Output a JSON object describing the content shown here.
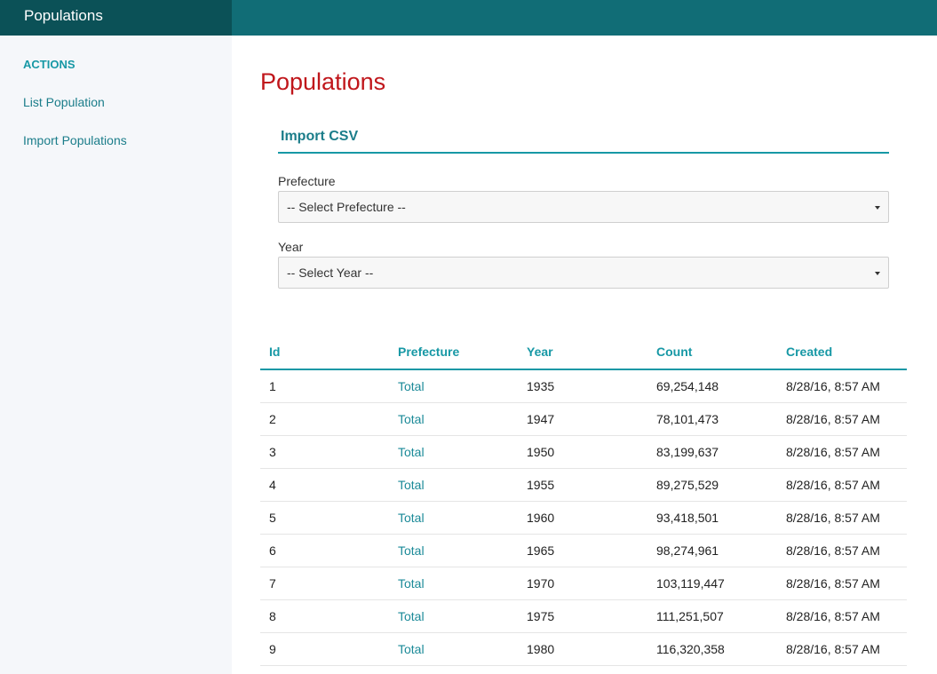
{
  "header": {
    "brand": "Populations"
  },
  "sidebar": {
    "heading": "ACTIONS",
    "items": [
      {
        "label": "List Population"
      },
      {
        "label": "Import Populations"
      }
    ]
  },
  "main": {
    "title": "Populations",
    "import_form": {
      "legend": "Import CSV",
      "prefecture_label": "Prefecture",
      "prefecture_value": "-- Select Prefecture --",
      "year_label": "Year",
      "year_value": "-- Select Year --"
    },
    "table": {
      "columns": [
        "Id",
        "Prefecture",
        "Year",
        "Count",
        "Created"
      ],
      "rows": [
        {
          "id": "1",
          "prefecture": "Total",
          "year": "1935",
          "count": "69,254,148",
          "created": "8/28/16, 8:57 AM"
        },
        {
          "id": "2",
          "prefecture": "Total",
          "year": "1947",
          "count": "78,101,473",
          "created": "8/28/16, 8:57 AM"
        },
        {
          "id": "3",
          "prefecture": "Total",
          "year": "1950",
          "count": "83,199,637",
          "created": "8/28/16, 8:57 AM"
        },
        {
          "id": "4",
          "prefecture": "Total",
          "year": "1955",
          "count": "89,275,529",
          "created": "8/28/16, 8:57 AM"
        },
        {
          "id": "5",
          "prefecture": "Total",
          "year": "1960",
          "count": "93,418,501",
          "created": "8/28/16, 8:57 AM"
        },
        {
          "id": "6",
          "prefecture": "Total",
          "year": "1965",
          "count": "98,274,961",
          "created": "8/28/16, 8:57 AM"
        },
        {
          "id": "7",
          "prefecture": "Total",
          "year": "1970",
          "count": "103,119,447",
          "created": "8/28/16, 8:57 AM"
        },
        {
          "id": "8",
          "prefecture": "Total",
          "year": "1975",
          "count": "111,251,507",
          "created": "8/28/16, 8:57 AM"
        },
        {
          "id": "9",
          "prefecture": "Total",
          "year": "1980",
          "count": "116,320,358",
          "created": "8/28/16, 8:57 AM"
        }
      ]
    }
  },
  "colors": {
    "header_bg": "#116d76",
    "brand_bg": "#0b5157",
    "accent": "#1798a5",
    "title_red": "#c0161b",
    "sidebar_bg": "#f5f7fa"
  }
}
